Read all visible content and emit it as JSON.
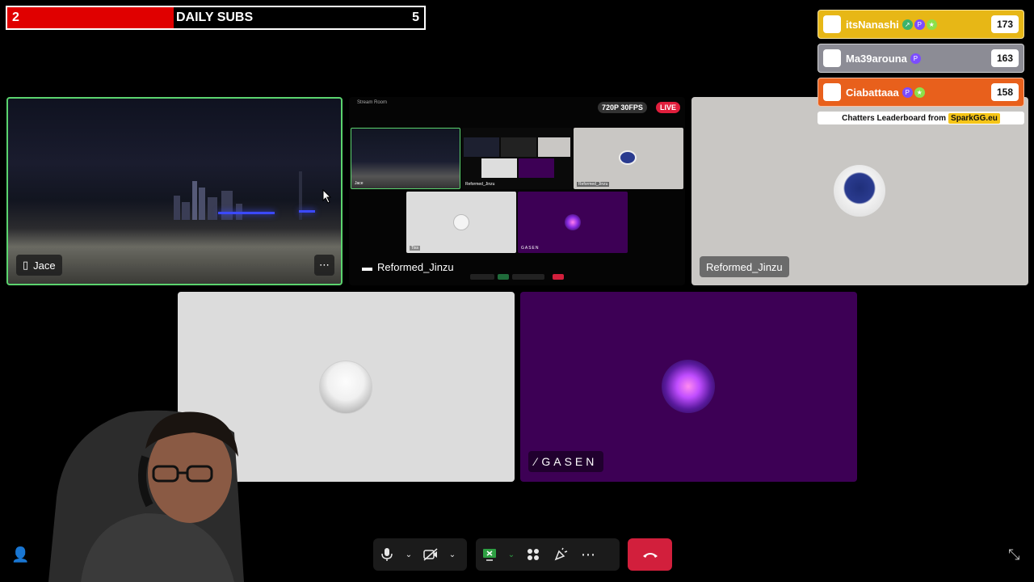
{
  "subs": {
    "current": "2",
    "label": "DAILY SUBS",
    "goal": "5",
    "progress_fraction": 0.4
  },
  "tiles": {
    "jace": {
      "name": "Jace"
    },
    "screen_share": {
      "name": "Reformed_Jinzu",
      "quality_badge": "720P 30FPS",
      "live_badge": "LIVE",
      "mini_window_title": "Stream Room",
      "mini_labels": {
        "jace": "Jace",
        "reformed": "Reformed_Jinzu",
        "reformed2": "Reformed_Jinzu",
        "avatar": "Tiss",
        "gasen": "GASEN"
      }
    },
    "cat": {
      "name": "Reformed_Jinzu"
    },
    "gasen": {
      "name": "GASEN"
    }
  },
  "leaderboard": {
    "rows": [
      {
        "name": "itsNanashi",
        "score": "173",
        "color": "#e7b716"
      },
      {
        "name": "Ma39arouna",
        "score": "163",
        "color": "#8c8c95"
      },
      {
        "name": "Ciabattaaa",
        "score": "158",
        "color": "#e8601c"
      }
    ],
    "footer_text": "Chatters Leaderboard from",
    "footer_brand": "SparkGG.eu"
  },
  "toolbar": {
    "icons": [
      "microphone-icon",
      "camera-off-icon",
      "screen-share-icon",
      "apps-icon",
      "reactions-icon",
      "more-icon",
      "end-call-icon"
    ]
  },
  "colors": {
    "active_border": "#5bd46e",
    "end_call": "#d21f3c",
    "subs_fill": "#e00000",
    "gasen_bg": "#3d0055"
  }
}
